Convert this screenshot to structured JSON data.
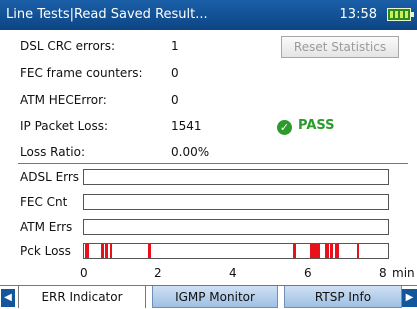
{
  "header": {
    "title": "Line Tests|Read Saved Result...",
    "time": "13:58"
  },
  "stats": [
    {
      "label": "DSL CRC errors:",
      "value": "1"
    },
    {
      "label": "FEC frame counters:",
      "value": "0"
    },
    {
      "label": "ATM HECError:",
      "value": "0"
    },
    {
      "label": "IP Packet Loss:",
      "value": "1541"
    },
    {
      "label": "Loss Ratio:",
      "value": "0.00%"
    }
  ],
  "reset_button": "Reset Statistics",
  "status": {
    "text": "PASS",
    "color": "#2c9b2c",
    "icon": "check-circle-icon"
  },
  "chart_data": {
    "type": "bar",
    "title": "",
    "rows": [
      "ADSL Errs",
      "FEC Cnt",
      "ATM Errs",
      "Pck Loss"
    ],
    "x_ticks": [
      "0",
      "2",
      "4",
      "6",
      "8"
    ],
    "x_unit": "min",
    "xlim": [
      0,
      8
    ],
    "mark_color": "#e8111b",
    "events": {
      "ADSL Errs": [],
      "FEC Cnt": [],
      "ATM Errs": [],
      "Pck Loss": [
        [
          0.02,
          0.12
        ],
        [
          0.45,
          0.52
        ],
        [
          0.55,
          0.62
        ],
        [
          0.68,
          0.75
        ],
        [
          1.68,
          1.76
        ],
        [
          5.5,
          5.58
        ],
        [
          5.94,
          6.22
        ],
        [
          6.33,
          6.45
        ],
        [
          6.48,
          6.55
        ],
        [
          6.6,
          6.7
        ],
        [
          7.18,
          7.25
        ]
      ]
    }
  },
  "tabs": [
    {
      "label": "ERR Indicator",
      "active": true
    },
    {
      "label": "IGMP Monitor",
      "active": false
    },
    {
      "label": "RTSP Info",
      "active": false
    }
  ]
}
